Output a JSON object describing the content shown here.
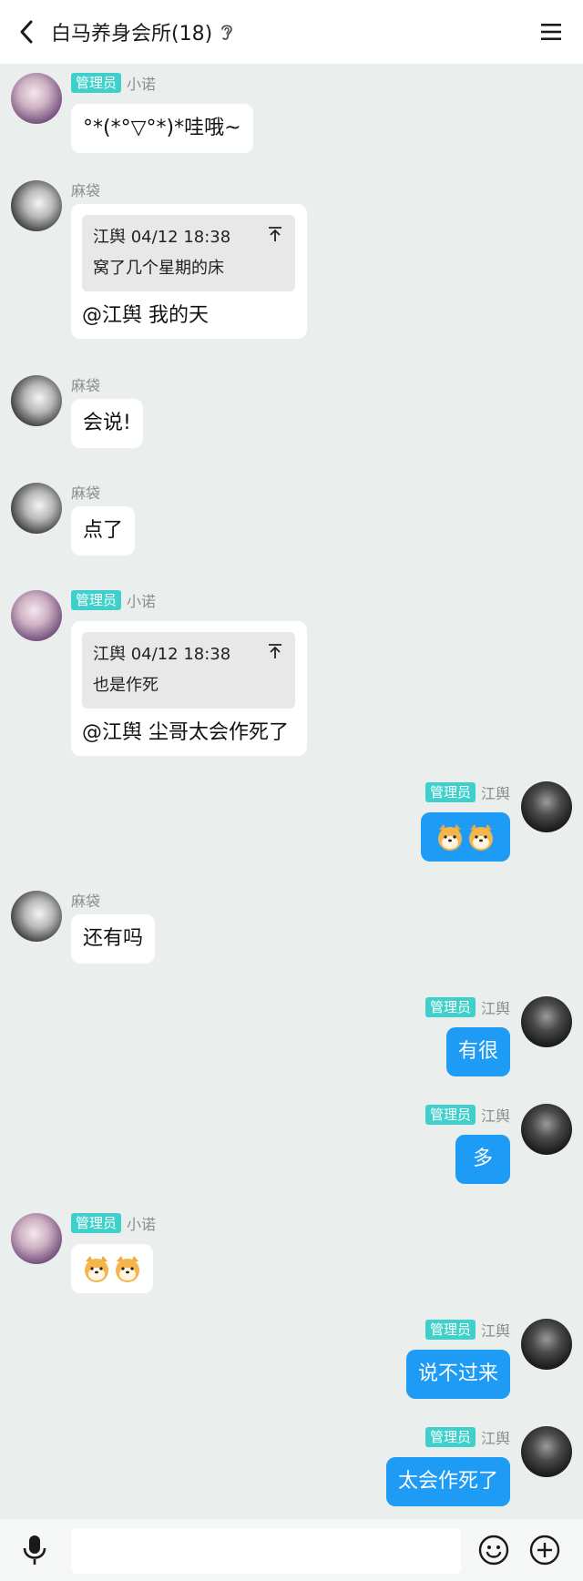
{
  "header": {
    "title": "白马养身会所(18)"
  },
  "badge_label": "管理员",
  "users": {
    "xiaonuo": "小诺",
    "madai": "麻袋",
    "jiangyu": "江舆"
  },
  "messages": [
    {
      "text": "°*(*°▽°*)*哇哦~"
    },
    {
      "quote_header": "江舆 04/12 18:38",
      "quote_text": "窝了几个星期的床",
      "text": "@江舆 我的天"
    },
    {
      "text": "会说!"
    },
    {
      "text": "点了"
    },
    {
      "quote_header": "江舆 04/12 18:38",
      "quote_text": "也是作死",
      "text": "@江舆 尘哥太会作死了"
    },
    {
      "emoji": [
        "shiba-emoji",
        "shiba-emoji"
      ]
    },
    {
      "text": "还有吗"
    },
    {
      "text": "有很"
    },
    {
      "text": "多"
    },
    {
      "emoji": [
        "shiba-emoji",
        "shiba-emoji"
      ]
    },
    {
      "text": "说不过来"
    },
    {
      "text": "太会作死了"
    }
  ],
  "input": {
    "placeholder": ""
  },
  "colors": {
    "accent_blue": "#1e9bf5",
    "admin_badge": "#3fd0cc",
    "background": "#eaeeec"
  }
}
